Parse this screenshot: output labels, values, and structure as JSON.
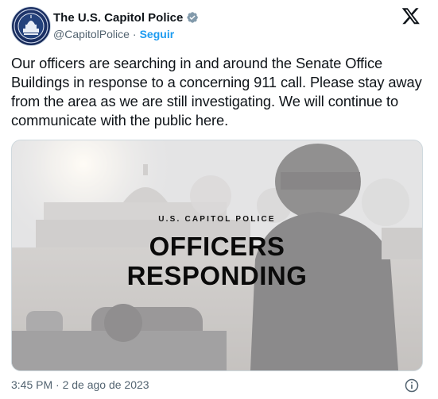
{
  "tweet": {
    "author_name": "The U.S. Capitol Police",
    "handle": "@CapitolPolice",
    "separator": "·",
    "follow_label": "Seguir",
    "text": "Our officers are searching in and around the Senate Office Buildings in response to a concerning 911 call. Please stay away from the area as we are still investigating. We will continue to communicate with the public here.",
    "timestamp": "3:45 PM · 2 de ago de 2023"
  },
  "media": {
    "kicker": "U.S. CAPITOL POLICE",
    "title_line1": "OFFICERS",
    "title_line2": "RESPONDING"
  },
  "icons": {
    "verified": "verified-badge-icon",
    "brand": "x-logo-icon",
    "info": "info-icon"
  },
  "colors": {
    "accent": "#1d9bf0",
    "text": "#0f1419",
    "secondary": "#536471",
    "verified_badge": "#829aab"
  }
}
